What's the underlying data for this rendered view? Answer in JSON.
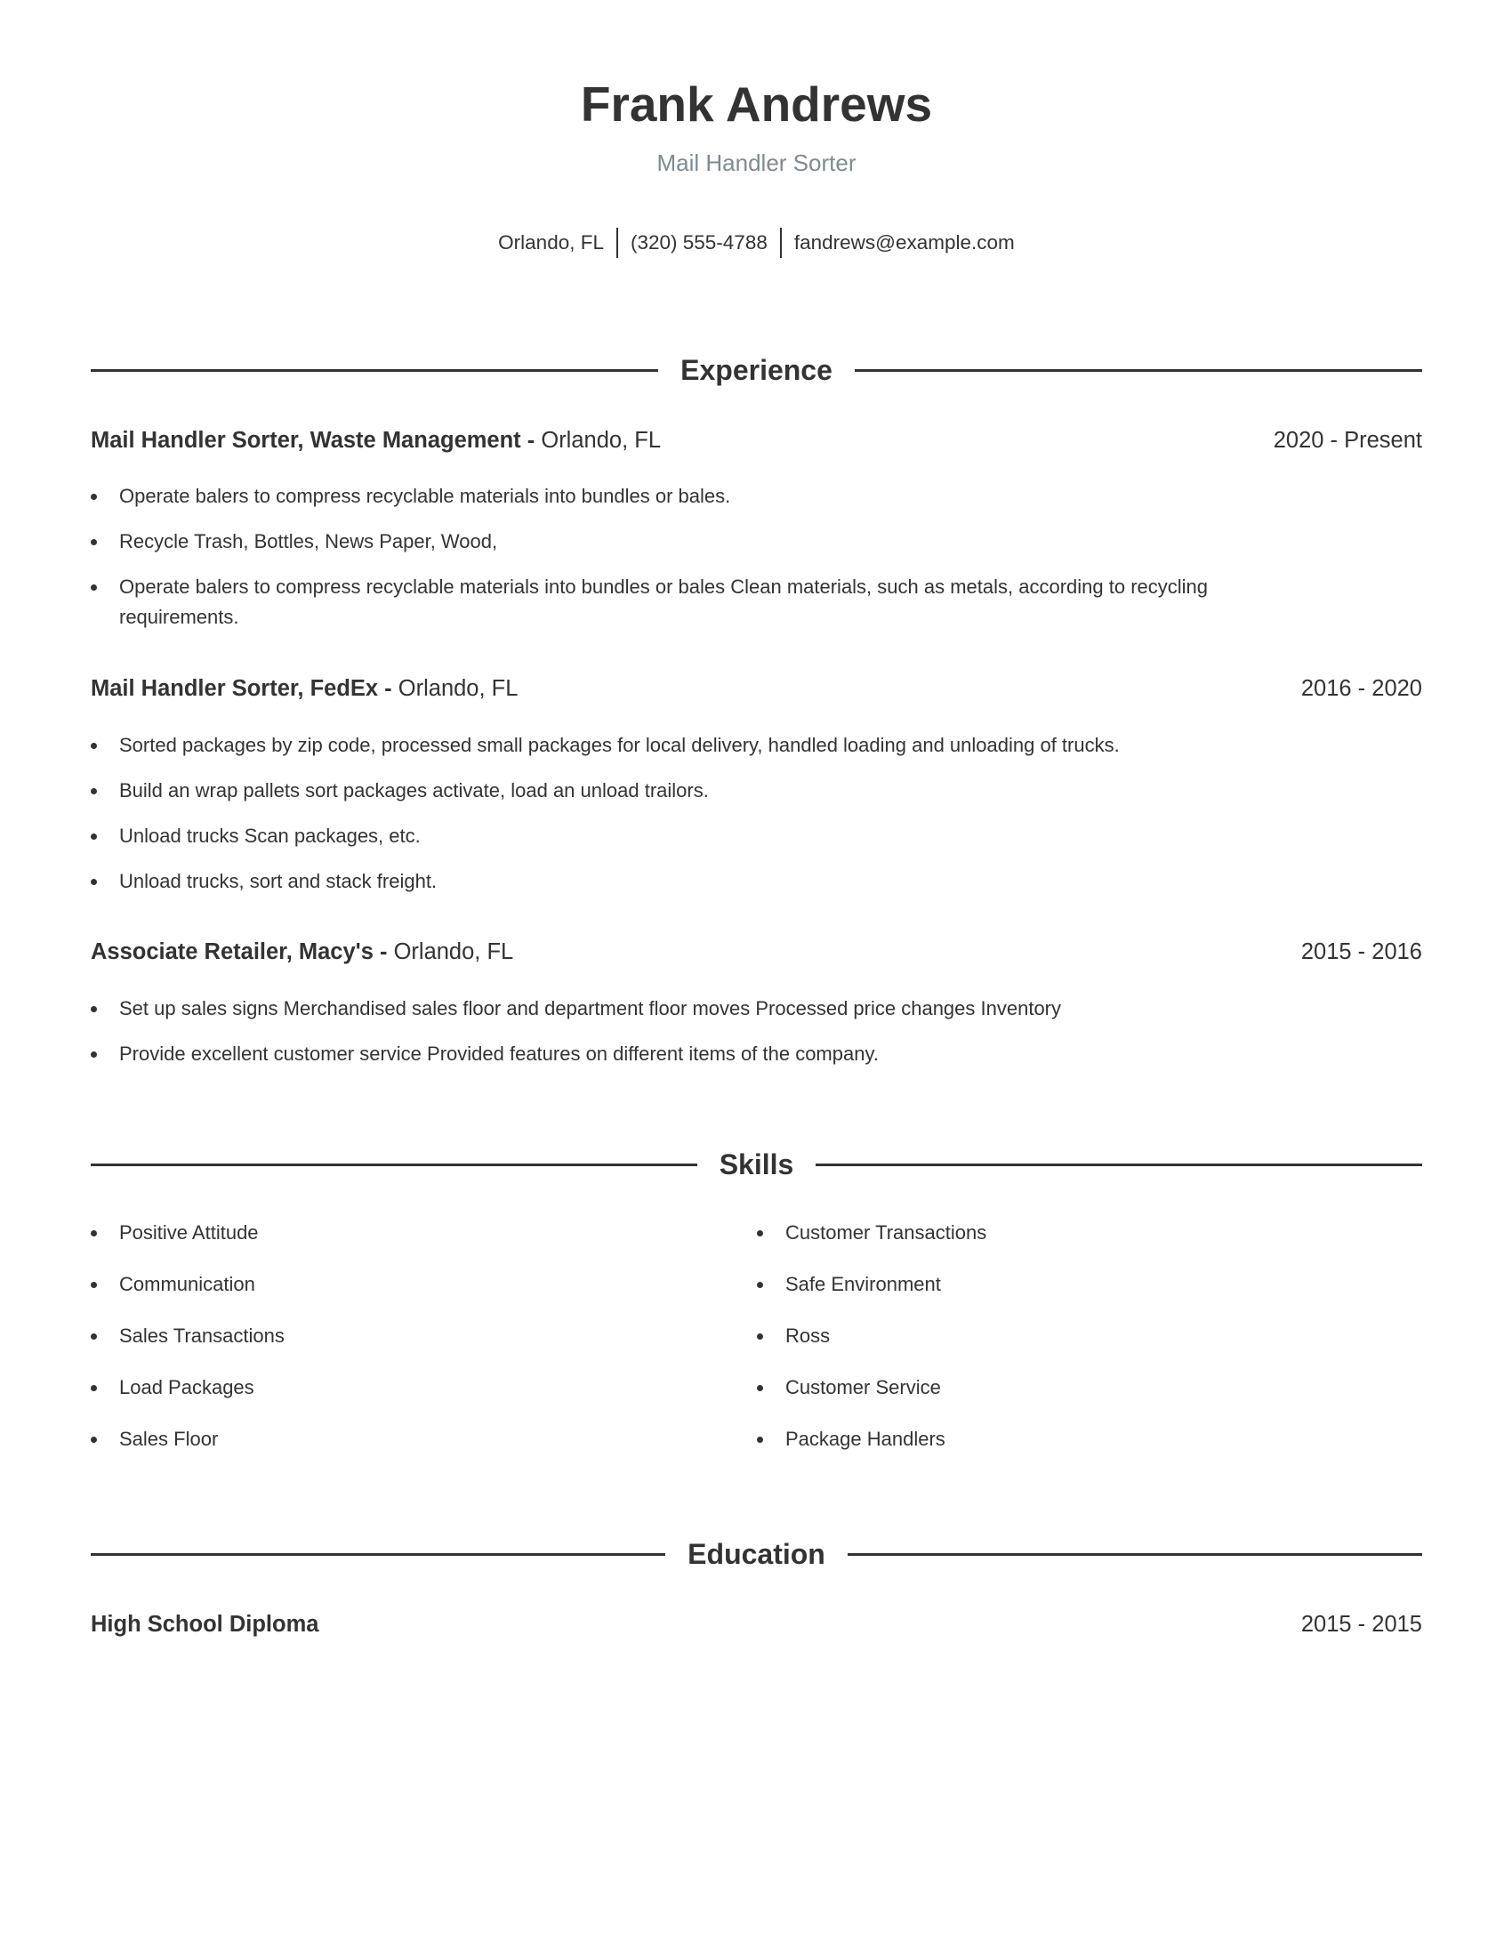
{
  "header": {
    "name": "Frank Andrews",
    "title": "Mail Handler Sorter",
    "contact": {
      "location": "Orlando, FL",
      "phone": "(320) 555-4788",
      "email": "fandrews@example.com"
    }
  },
  "sections": {
    "experience": "Experience",
    "skills": "Skills",
    "education": "Education"
  },
  "experience": [
    {
      "title": "Mail Handler Sorter, Waste Management -",
      "location": "Orlando, FL",
      "dates": "2020 - Present",
      "bullets": [
        "Operate balers to compress recyclable materials into bundles or bales.",
        "Recycle Trash, Bottles, News Paper, Wood,",
        "Operate balers to compress recyclable materials into bundles or bales Clean materials, such as metals, according to recycling requirements."
      ]
    },
    {
      "title": "Mail Handler Sorter, FedEx -",
      "location": "Orlando, FL",
      "dates": "2016 - 2020",
      "bullets": [
        "Sorted packages by zip code, processed small packages for local delivery, handled loading and unloading of trucks.",
        "Build an wrap pallets sort packages activate, load an unload trailors.",
        "Unload trucks Scan packages, etc.",
        "Unload trucks, sort and stack freight."
      ]
    },
    {
      "title": "Associate Retailer, Macy's -",
      "location": "Orlando, FL",
      "dates": "2015 - 2016",
      "bullets": [
        "Set up sales signs Merchandised sales floor and department floor moves Processed price changes Inventory",
        "Provide excellent customer service Provided features on different items of the company."
      ]
    }
  ],
  "skills": {
    "left": [
      "Positive Attitude",
      "Communication",
      "Sales Transactions",
      "Load Packages",
      "Sales Floor"
    ],
    "right": [
      "Customer Transactions",
      "Safe Environment",
      "Ross",
      "Customer Service",
      "Package Handlers"
    ]
  },
  "education": [
    {
      "degree": "High School Diploma",
      "dates": "2015 - 2015"
    }
  ],
  "colors": {
    "text": "#333333",
    "subtitle": "#7e8a94",
    "rule": "#333333"
  }
}
